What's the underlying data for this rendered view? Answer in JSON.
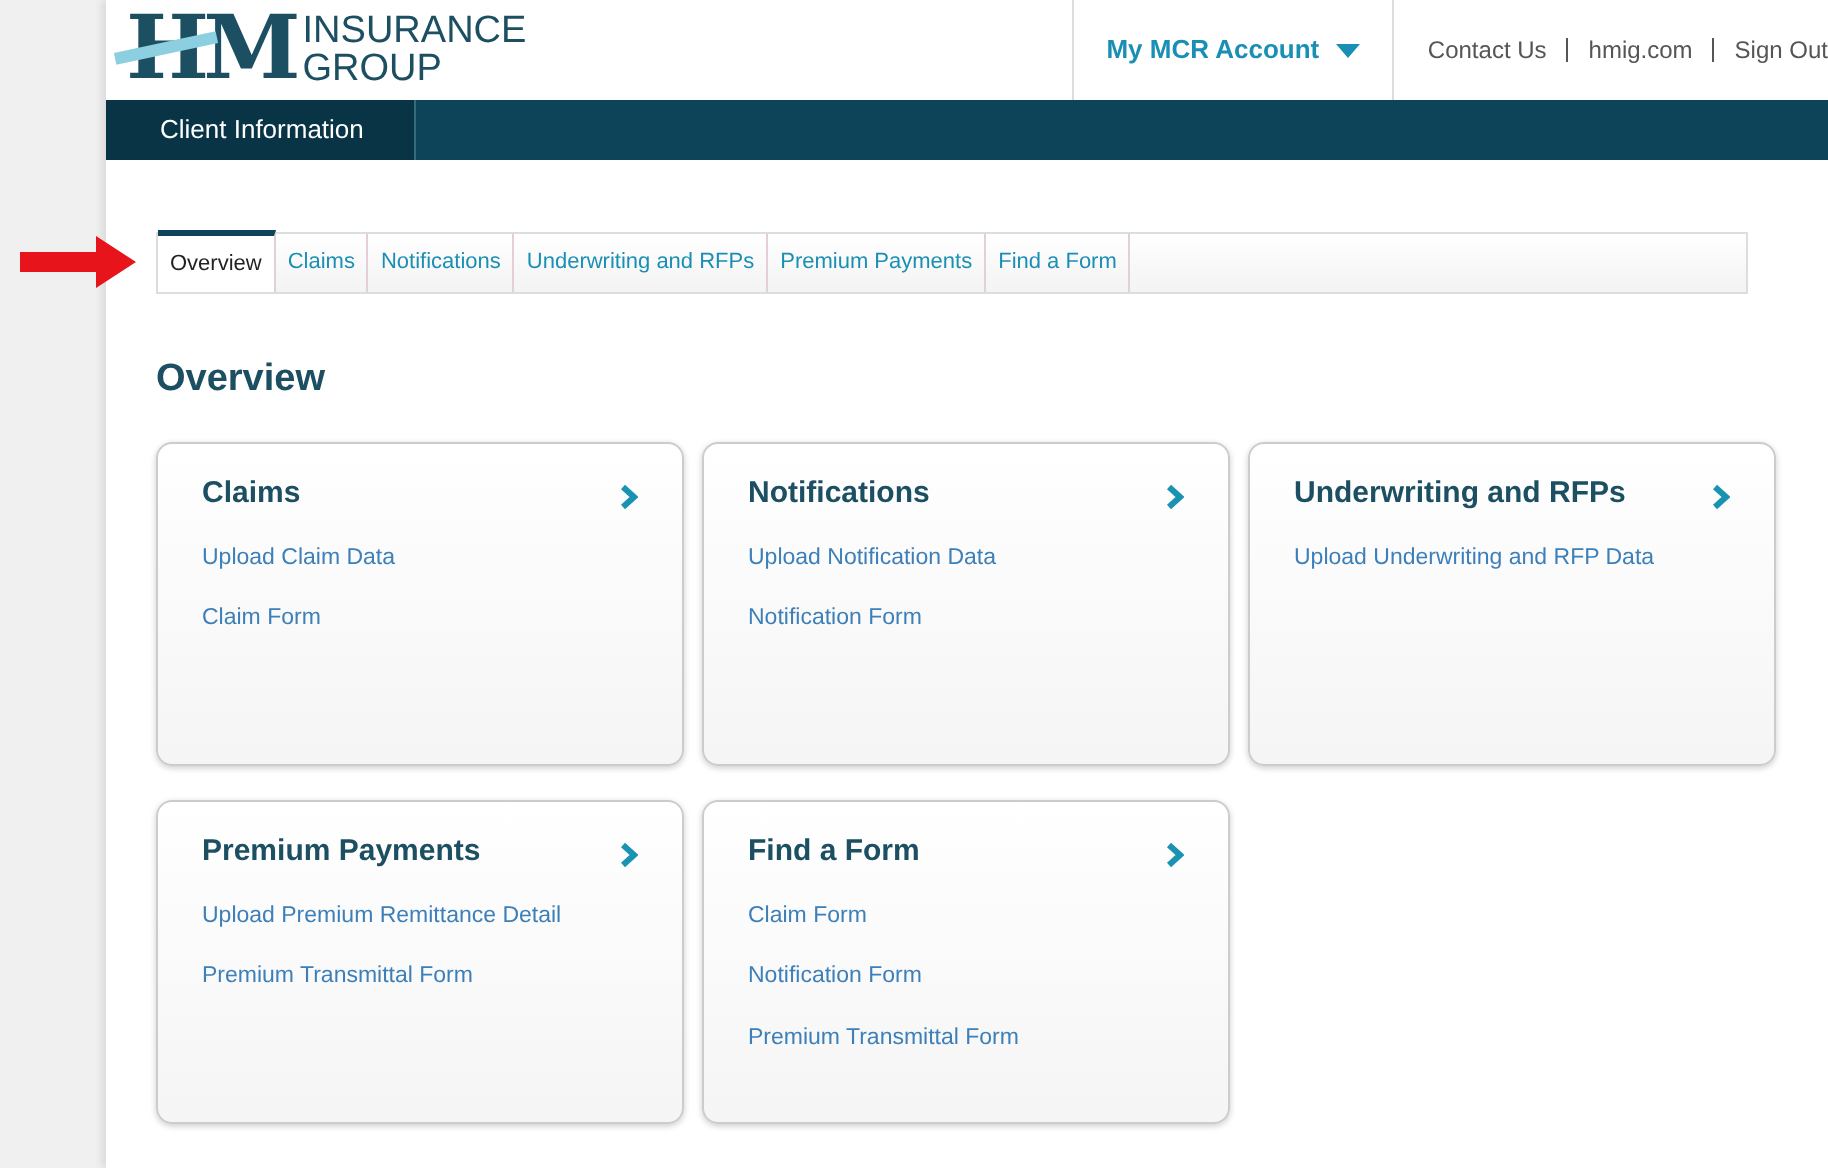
{
  "logo": {
    "letters": "HM",
    "line_1": "INSURANCE",
    "line_2": "GROUP"
  },
  "account_menu": {
    "label": "My MCR Account"
  },
  "top_links": [
    "Contact Us",
    "hmig.com",
    "Sign Out"
  ],
  "nav": [
    {
      "label": "Client Information",
      "selected": true
    }
  ],
  "tabs": [
    {
      "label": "Overview",
      "selected": true
    },
    {
      "label": "Claims",
      "selected": false
    },
    {
      "label": "Notifications",
      "selected": false
    },
    {
      "label": "Underwriting and RFPs",
      "selected": false
    },
    {
      "label": "Premium Payments",
      "selected": false
    },
    {
      "label": "Find a Form",
      "selected": false
    }
  ],
  "heading": "Overview",
  "cards": [
    {
      "title": "Claims",
      "links": [
        "Upload Claim Data",
        "Claim Form"
      ]
    },
    {
      "title": "Notifications",
      "links": [
        "Upload Notification Data",
        "Notification Form"
      ]
    },
    {
      "title": "Underwriting and RFPs",
      "links": [
        "Upload Underwriting and RFP Data"
      ]
    },
    {
      "title": "Premium Payments",
      "links": [
        "Upload Premium Remittance Detail",
        "Premium Transmittal Form"
      ]
    },
    {
      "title": "Find a Form",
      "links": [
        "Claim Form",
        "Notification Form",
        "Premium Transmittal Form"
      ]
    }
  ]
}
